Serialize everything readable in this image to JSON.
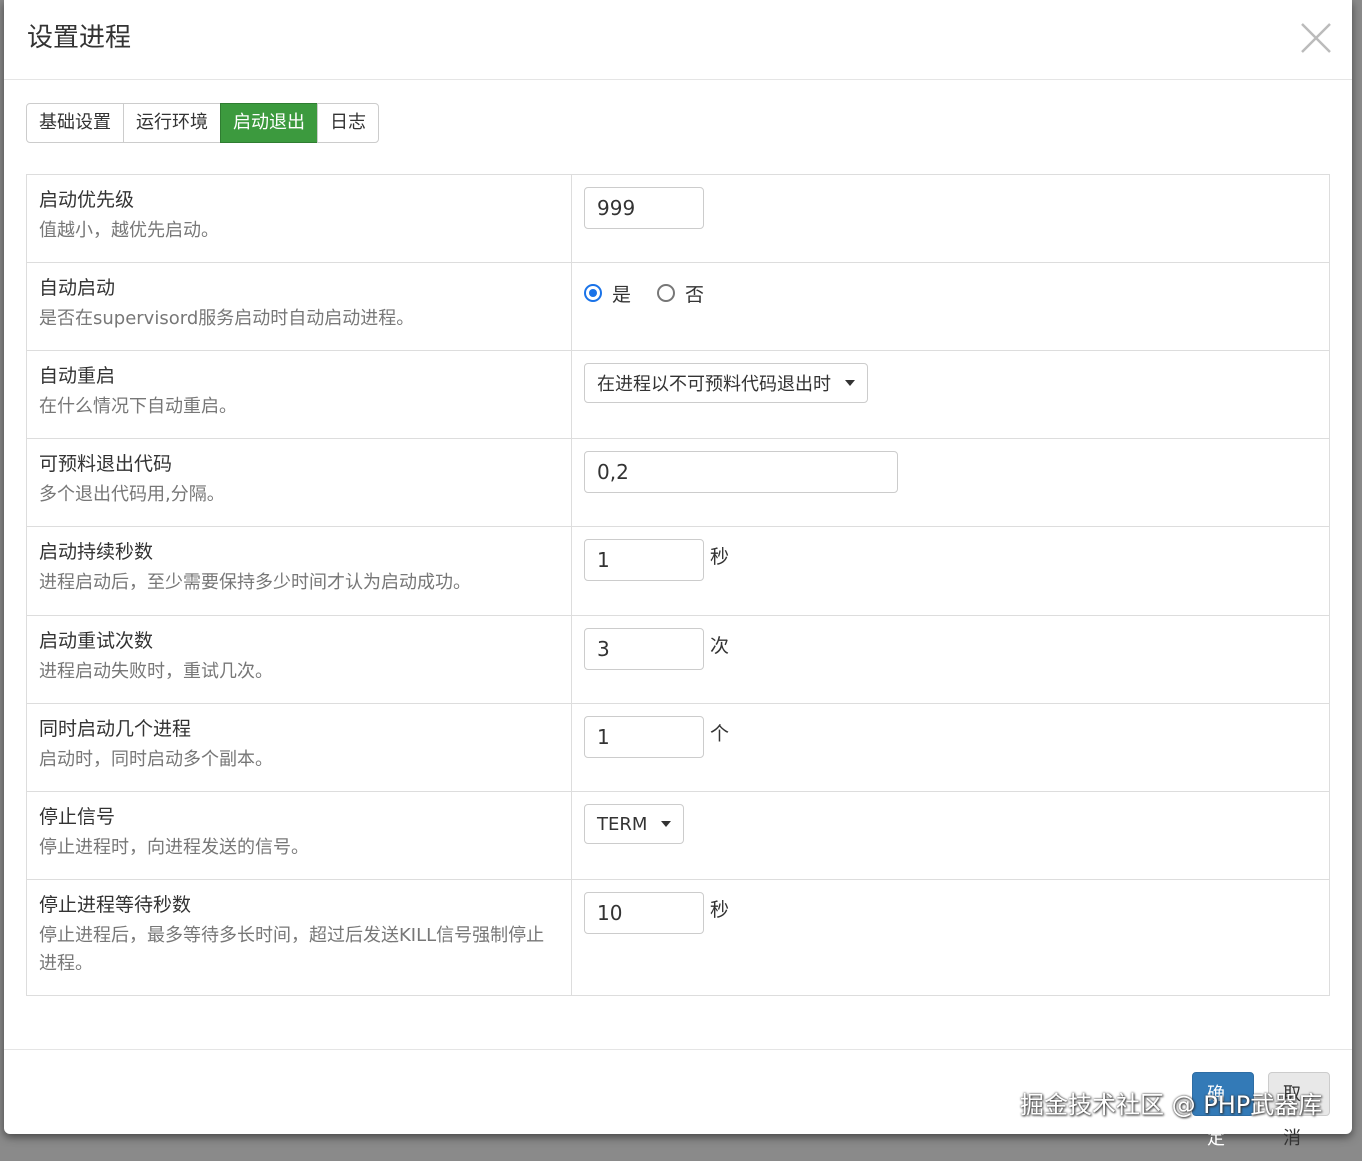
{
  "dialog": {
    "title": "设置进程"
  },
  "tabs": [
    {
      "label": "基础设置",
      "active": false
    },
    {
      "label": "运行环境",
      "active": false
    },
    {
      "label": "启动退出",
      "active": true
    },
    {
      "label": "日志",
      "active": false
    }
  ],
  "rows": {
    "priority": {
      "title": "启动优先级",
      "desc": "值越小，越优先启动。",
      "value": "999"
    },
    "autostart": {
      "title": "自动启动",
      "desc": "是否在supervisord服务启动时自动启动进程。",
      "options": [
        "是",
        "否"
      ],
      "selected": "是"
    },
    "autorestart": {
      "title": "自动重启",
      "desc": "在什么情况下自动重启。",
      "value": "在进程以不可预料代码退出时"
    },
    "exitcodes": {
      "title": "可预料退出代码",
      "desc": "多个退出代码用,分隔。",
      "value": "0,2"
    },
    "startsecs": {
      "title": "启动持续秒数",
      "desc": "进程启动后，至少需要保持多少时间才认为启动成功。",
      "value": "1",
      "unit": "秒"
    },
    "startretries": {
      "title": "启动重试次数",
      "desc": "进程启动失败时，重试几次。",
      "value": "3",
      "unit": "次"
    },
    "numprocs": {
      "title": "同时启动几个进程",
      "desc": "启动时，同时启动多个副本。",
      "value": "1",
      "unit": "个"
    },
    "stopsignal": {
      "title": "停止信号",
      "desc": "停止进程时，向进程发送的信号。",
      "value": "TERM"
    },
    "stopwaitsecs": {
      "title": "停止进程等待秒数",
      "desc": "停止进程后，最多等待多长时间，超过后发送KILL信号强制停止进程。",
      "value": "10",
      "unit": "秒"
    }
  },
  "footer": {
    "confirm_label": "确定",
    "cancel_label": "取消"
  },
  "watermark": "掘金技术社区 @ PHP武器库",
  "colors": {
    "active_tab": "#3c9a3e",
    "primary": "#337ab7",
    "radio_checked": "#1a73e8"
  }
}
